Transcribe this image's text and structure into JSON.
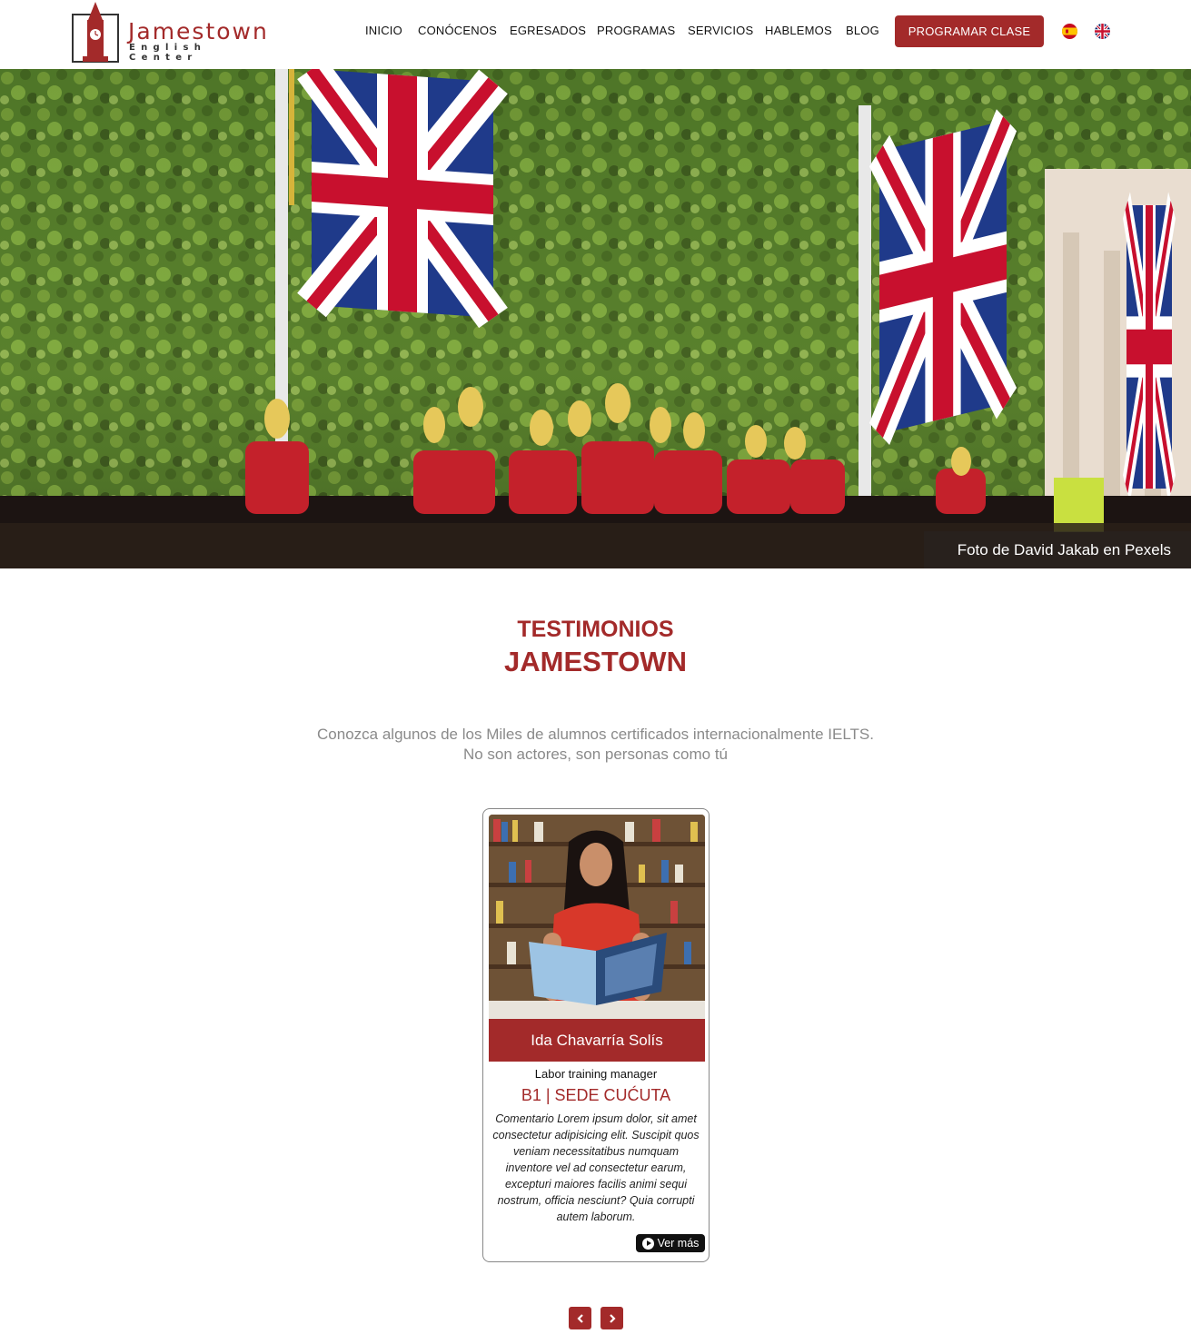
{
  "header": {
    "brand_name": "Jamestown",
    "brand_sub": "English Center",
    "logo_icon": "big-ben-logo",
    "nav": [
      {
        "label": "INICIO"
      },
      {
        "label": "CONÓCENOS"
      },
      {
        "label": "EGRESADOS"
      },
      {
        "label": "PROGRAMAS"
      },
      {
        "label": "SERVICIOS"
      },
      {
        "label": "HABLEMOS"
      },
      {
        "label": "BLOG"
      }
    ],
    "cta_label": "PROGRAMAR CLASE",
    "languages": [
      {
        "icon": "spain-flag-icon"
      },
      {
        "icon": "uk-flag-icon"
      }
    ]
  },
  "hero": {
    "credit": "Foto de David Jakab en Pexels"
  },
  "testimonials": {
    "title_line1": "TESTIMONIOS",
    "title_line2": "JAMESTOWN",
    "subtitle_line1": "Conozca algunos de los Miles de alumnos certificados internacionalmente IELTS.",
    "subtitle_line2": "No son actores, son personas como tú",
    "cards": [
      {
        "name": "Ida Chavarría Solís",
        "role": "Labor training manager",
        "level": "B1 | SEDE CUĆUTA",
        "comment": "Comentario Lorem ipsum dolor, sit amet consectetur adipisicing elit. Suscipit quos veniam necessitatibus numquam inventore vel ad consectetur earum, excepturi maiores facilis animi sequi nostrum, officia nesciunt? Quia corrupti autem laborum.",
        "more_label": "Ver más"
      }
    ],
    "prev_icon": "chevron-left-icon",
    "next_icon": "chevron-right-icon"
  },
  "colors": {
    "brand": "#a32a2a",
    "text": "#111111",
    "muted": "#8a8a8a"
  }
}
